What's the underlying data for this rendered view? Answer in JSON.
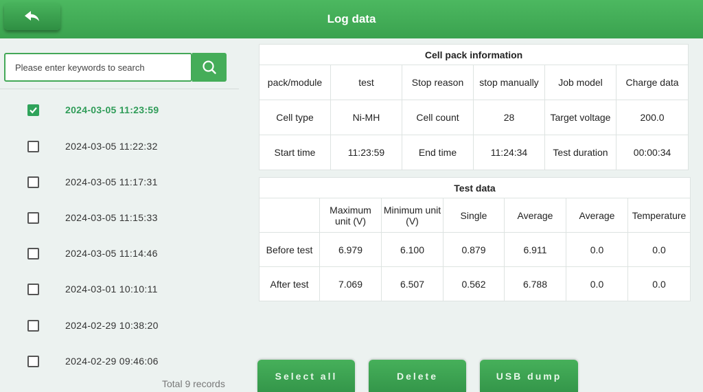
{
  "header": {
    "title": "Log data"
  },
  "search": {
    "placeholder": "Please enter keywords to search"
  },
  "records": [
    {
      "label": "2024-03-05 11:23:59",
      "checked": true
    },
    {
      "label": "2024-03-05 11:22:32",
      "checked": false
    },
    {
      "label": "2024-03-05 11:17:31",
      "checked": false
    },
    {
      "label": "2024-03-05 11:15:33",
      "checked": false
    },
    {
      "label": "2024-03-05 11:14:46",
      "checked": false
    },
    {
      "label": "2024-03-01 10:10:11",
      "checked": false
    },
    {
      "label": "2024-02-29 10:38:20",
      "checked": false
    },
    {
      "label": "2024-02-29 09:46:06",
      "checked": false
    }
  ],
  "total_records": "Total 9 records",
  "cell_info": {
    "title": "Cell pack information",
    "rows": [
      [
        "pack/module",
        "test",
        "Stop reason",
        "stop manually",
        "Job model",
        "Charge data"
      ],
      [
        "Cell type",
        "Ni-MH",
        "Cell count",
        "28",
        "Target voltage",
        "200.0"
      ],
      [
        "Start time",
        "11:23:59",
        "End time",
        "11:24:34",
        "Test duration",
        "00:00:34"
      ]
    ]
  },
  "test_data": {
    "title": "Test data",
    "headers": [
      "",
      "Maximum unit (V)",
      "Minimum unit (V)",
      "Single",
      "Average",
      "Average",
      "Temperature"
    ],
    "rows": [
      [
        "Before test",
        "6.979",
        "6.100",
        "0.879",
        "6.911",
        "0.0",
        "0.0"
      ],
      [
        "After test",
        "7.069",
        "6.507",
        "0.562",
        "6.788",
        "0.0",
        "0.0"
      ]
    ]
  },
  "buttons": {
    "select_all": "Select all",
    "delete": "Delete",
    "usb_dump": "USB dump"
  },
  "colors": {
    "header": "#3aa24f",
    "accent": "#45ad59",
    "checked_text": "#2f9c58"
  },
  "icons": {
    "back": "back-arrow-icon",
    "search": "search-icon",
    "check": "check-icon"
  }
}
